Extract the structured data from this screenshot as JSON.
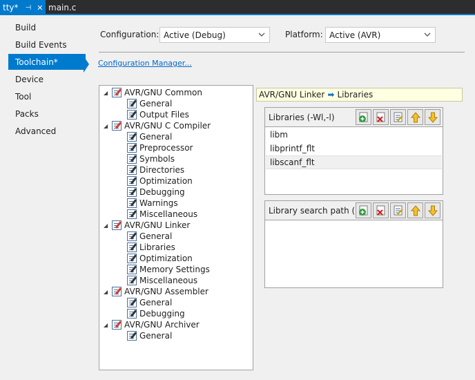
{
  "tabs": {
    "active": {
      "label": "tty*",
      "pin": "⊣",
      "close": "✕"
    },
    "inactive": {
      "label": "main.c"
    }
  },
  "nav": {
    "items": [
      {
        "label": "Build"
      },
      {
        "label": "Build Events"
      },
      {
        "label": "Toolchain*",
        "selected": true
      },
      {
        "label": "Device"
      },
      {
        "label": "Tool"
      },
      {
        "label": "Packs"
      },
      {
        "label": "Advanced"
      }
    ]
  },
  "config": {
    "configuration_label": "Configuration:",
    "configuration_value": "Active (Debug)",
    "platform_label": "Platform:",
    "platform_value": "Active (AVR)",
    "manager_link": "Configuration Manager..."
  },
  "tree": {
    "nodes": [
      {
        "label": "AVR/GNU Common",
        "level": 0
      },
      {
        "label": "General",
        "level": 1
      },
      {
        "label": "Output Files",
        "level": 1
      },
      {
        "label": "AVR/GNU C Compiler",
        "level": 0
      },
      {
        "label": "General",
        "level": 1
      },
      {
        "label": "Preprocessor",
        "level": 1
      },
      {
        "label": "Symbols",
        "level": 1
      },
      {
        "label": "Directories",
        "level": 1
      },
      {
        "label": "Optimization",
        "level": 1
      },
      {
        "label": "Debugging",
        "level": 1
      },
      {
        "label": "Warnings",
        "level": 1
      },
      {
        "label": "Miscellaneous",
        "level": 1
      },
      {
        "label": "AVR/GNU Linker",
        "level": 0
      },
      {
        "label": "General",
        "level": 1
      },
      {
        "label": "Libraries",
        "level": 1
      },
      {
        "label": "Optimization",
        "level": 1
      },
      {
        "label": "Memory Settings",
        "level": 1
      },
      {
        "label": "Miscellaneous",
        "level": 1
      },
      {
        "label": "AVR/GNU Assembler",
        "level": 0
      },
      {
        "label": "General",
        "level": 1
      },
      {
        "label": "Debugging",
        "level": 1
      },
      {
        "label": "AVR/GNU Archiver",
        "level": 0
      },
      {
        "label": "General",
        "level": 1
      }
    ]
  },
  "breadcrumb": {
    "parent": "AVR/GNU Linker",
    "arrow": "➡",
    "child": "Libraries"
  },
  "libraries_panel": {
    "title": "Libraries (-Wl,-l)",
    "items": [
      "libm",
      "libprintf_flt",
      "libscanf_flt"
    ],
    "selected_index": 2
  },
  "search_panel": {
    "title": "Library search path (-Wl,-L)",
    "items": []
  },
  "toolbar_icons": [
    "add-icon",
    "delete-icon",
    "edit-icon",
    "move-up-icon",
    "move-down-icon"
  ],
  "colors": {
    "accent": "#007acc",
    "link": "#0066cc",
    "breadcrumb_bg": "#ffffe1"
  }
}
